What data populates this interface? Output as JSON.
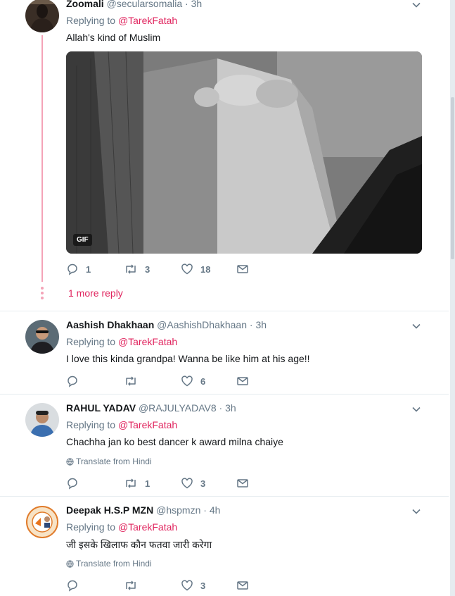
{
  "tweets": [
    {
      "name": "Zoomali",
      "handle": "@secularsomalia",
      "time": "3h",
      "replying_label": "Replying to",
      "replying_to": "@TarekFatah",
      "text": "Allah's kind of Muslim",
      "media_badge": "GIF",
      "replies": "1",
      "retweets": "3",
      "likes": "18"
    },
    {
      "name": "Aashish Dhakhaan",
      "handle": "@AashishDhakhaan",
      "time": "3h",
      "replying_label": "Replying to",
      "replying_to": "@TarekFatah",
      "text": "I love this kinda grandpa! Wanna be like him at his age!!",
      "replies": "",
      "retweets": "",
      "likes": "6"
    },
    {
      "name": "RAHUL YADAV",
      "handle": "@RAJULYADAV8",
      "time": "3h",
      "replying_label": "Replying to",
      "replying_to": "@TarekFatah",
      "text": "Chachha jan ko best dancer k award milna chaiye",
      "translate": "Translate from Hindi",
      "replies": "",
      "retweets": "1",
      "likes": "3"
    },
    {
      "name": "Deepak H.S.P MZN",
      "handle": "@hspmzn",
      "time": "4h",
      "replying_label": "Replying to",
      "replying_to": "@TarekFatah",
      "text": "जी इसके खिलाफ कौन फतवा जारी करेगा",
      "translate": "Translate from Hindi",
      "replies": "",
      "retweets": "",
      "likes": "3"
    }
  ],
  "more_replies": "1 more reply",
  "colors": {
    "mention": "#e0245e",
    "thread": "#f4a3b7",
    "muted": "#657786"
  },
  "icons": [
    "reply-icon",
    "retweet-icon",
    "like-icon",
    "dm-icon",
    "chevron-down-icon",
    "globe-icon"
  ]
}
